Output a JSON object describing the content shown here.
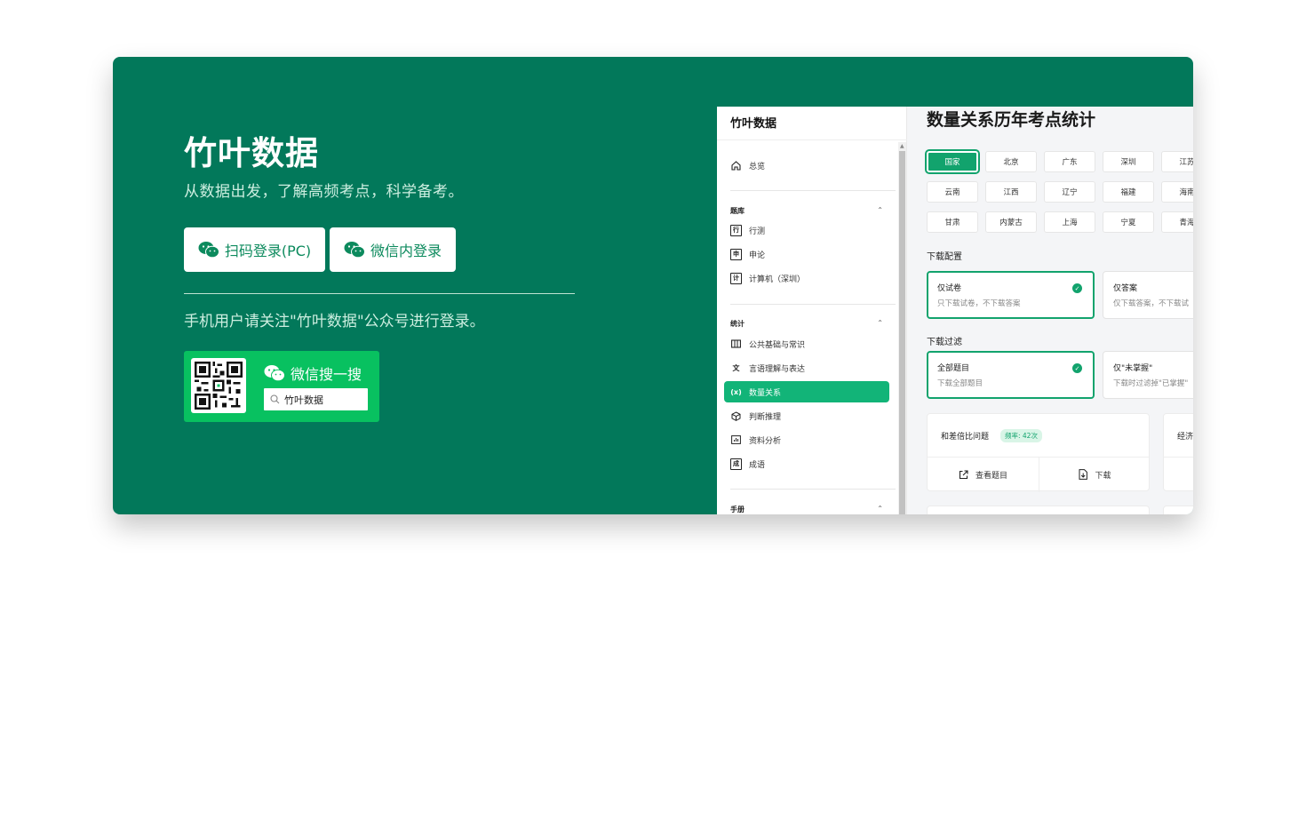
{
  "hero": {
    "title": "竹叶数据",
    "subtitle": "从数据出发，了解高频考点，科学备考。",
    "btn_pc": "扫码登录(PC)",
    "btn_inner": "微信内登录",
    "mobile_tip": "手机用户请关注\"竹叶数据\"公众号进行登录。",
    "wx_search_title": "微信搜一搜",
    "wx_search_query": "竹叶数据"
  },
  "colors": {
    "brand": "#02785a",
    "accent": "#12a36d",
    "wechat_green": "#08c160"
  },
  "preview": {
    "logo": "竹叶数据",
    "nav_overview": "总览",
    "sec_bank": "题库",
    "bank_items": [
      "行测",
      "申论",
      "计算机（深圳）"
    ],
    "bank_icons": [
      "行",
      "申",
      "计"
    ],
    "sec_stats": "统计",
    "stats_items": [
      "公共基础与常识",
      "言语理解与表达",
      "数量关系",
      "判断推理",
      "资料分析",
      "成语"
    ],
    "sec_manual": "手册",
    "page_title": "数量关系历年考点统计",
    "regions": [
      "国家",
      "北京",
      "广东",
      "深圳",
      "江苏",
      "云南",
      "江西",
      "辽宁",
      "福建",
      "海南",
      "甘肃",
      "内蒙古",
      "上海",
      "宁夏",
      "青海"
    ],
    "download_config_label": "下载配置",
    "config_options": [
      {
        "title": "仅试卷",
        "desc": "只下载试卷，不下载答案"
      },
      {
        "title": "仅答案",
        "desc": "仅下载答案，不下载试"
      }
    ],
    "download_filter_label": "下载过滤",
    "filter_options": [
      {
        "title": "全部题目",
        "desc": "下载全部题目"
      },
      {
        "title": "仅\"未掌握\"",
        "desc": "下载时过滤掉\"已掌握\""
      }
    ],
    "topic": {
      "name": "和差倍比问题",
      "freq": "频率: 42次",
      "view": "查看题目",
      "download": "下载"
    },
    "topic2_name": "经济"
  }
}
